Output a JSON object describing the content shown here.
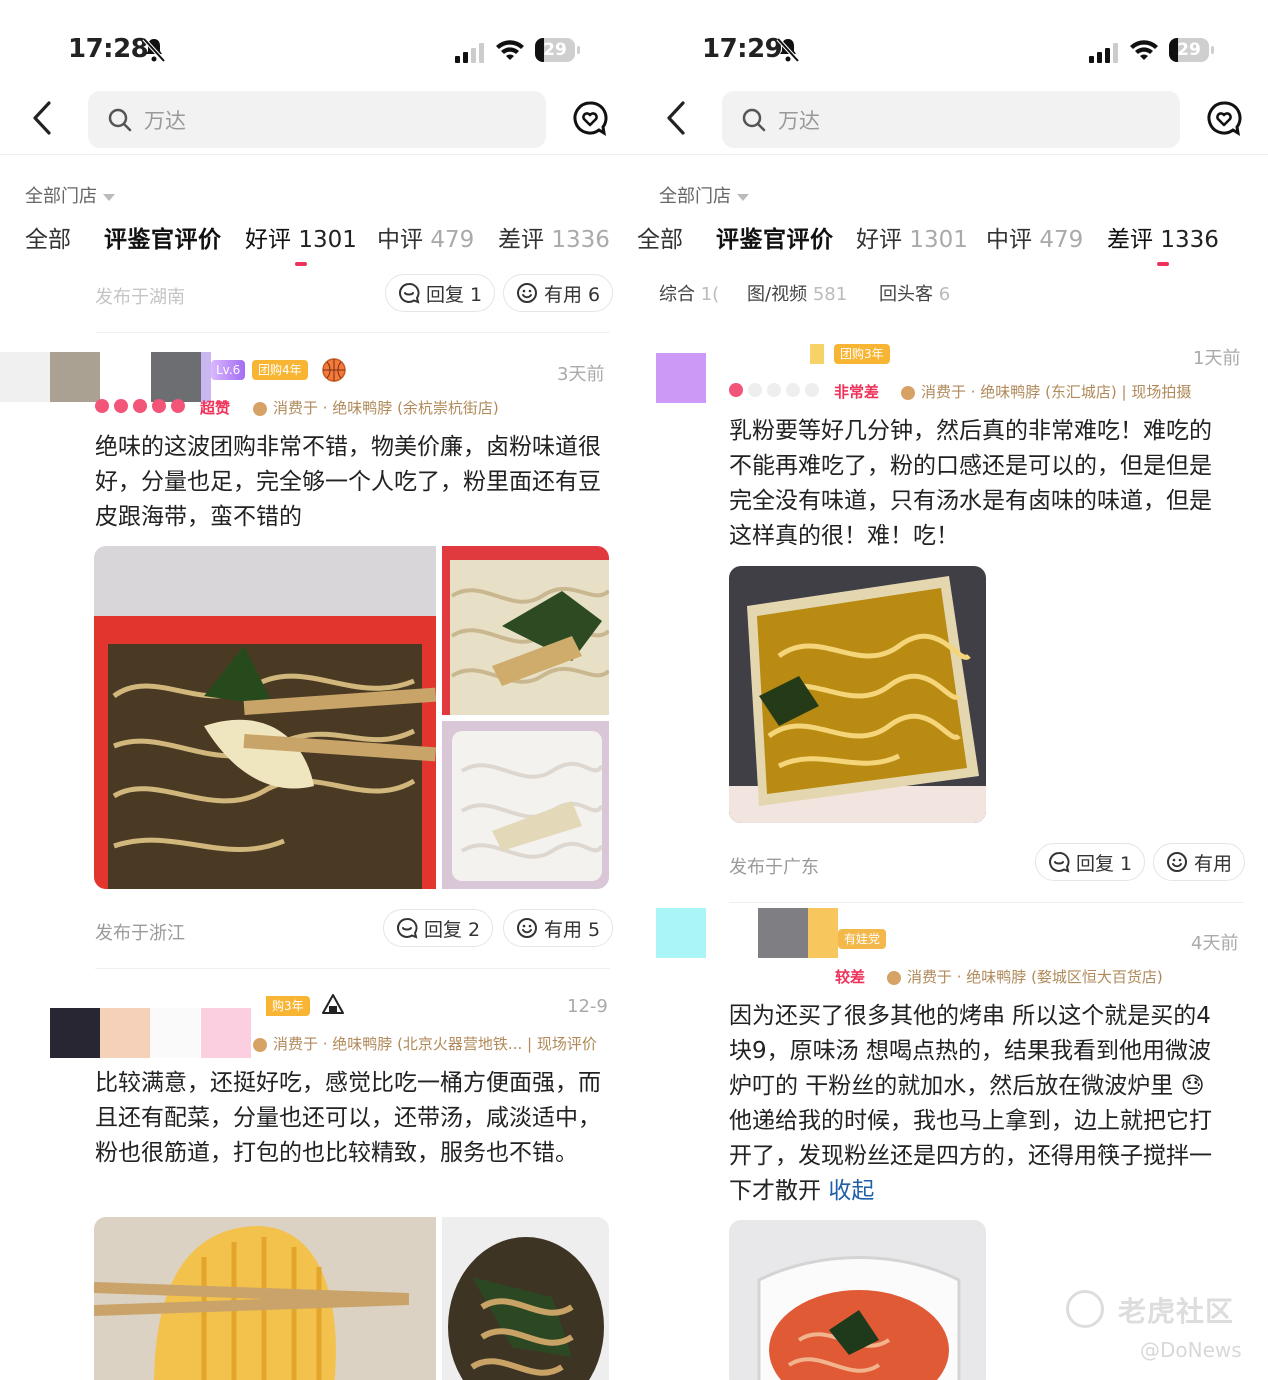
{
  "left": {
    "status": {
      "time": "17:28",
      "battery": "29"
    },
    "search": {
      "placeholder": "万达"
    },
    "store_filter": "全部门店",
    "tabs": [
      {
        "label": "全部",
        "count": ""
      },
      {
        "label": "评鉴官评价",
        "count": ""
      },
      {
        "label": "好评",
        "count": "1301"
      },
      {
        "label": "中评",
        "count": "479"
      },
      {
        "label": "差评",
        "count": "1336"
      }
    ],
    "prev_footer": {
      "location": "发布于湖南",
      "reply": "回复 1",
      "useful": "有用 6"
    },
    "reviews": [
      {
        "level": "Lv.6",
        "groupbuy": "团购4年",
        "time": "3天前",
        "rating_label": "超赞",
        "shop": "消费于 · 绝味鸭脖 (余杭崇杭街店)",
        "text": "绝味的这波团购非常不错，物美价廉，卤粉味道很好，分量也足，完全够一个人吃了，粉里面还有豆皮跟海带，蛮不错的",
        "location": "发布于浙江",
        "reply": "回复 2",
        "useful": "有用 5"
      },
      {
        "groupbuy": "购3年",
        "time": "12-9",
        "shop": "消费于 · 绝味鸭脖 (北京火器营地铁... | 现场评价",
        "text": "比较满意，还挺好吃，感觉比吃一桶方便面强，而且还有配菜，分量也还可以，还带汤，咸淡适中，粉也很筋道，打包的也比较精致，服务也不错。"
      }
    ]
  },
  "right": {
    "status": {
      "time": "17:29",
      "battery": "29"
    },
    "search": {
      "placeholder": "万达"
    },
    "store_filter": "全部门店",
    "tabs": [
      {
        "label": "全部",
        "count": ""
      },
      {
        "label": "评鉴官评价",
        "count": ""
      },
      {
        "label": "好评",
        "count": "1301"
      },
      {
        "label": "中评",
        "count": "479"
      },
      {
        "label": "差评",
        "count": "1336"
      }
    ],
    "subtabs": [
      {
        "label": "综合",
        "count": "1("
      },
      {
        "label": "图/视频",
        "count": "581"
      },
      {
        "label": "回头客",
        "count": "6"
      }
    ],
    "reviews": [
      {
        "groupbuy": "团购3年",
        "time": "1天前",
        "rating_label": "非常差",
        "shop": "消费于 · 绝味鸭脖 (东汇城店) | 现场拍摄",
        "text": "乳粉要等好几分钟，然后真的非常难吃！难吃的不能再难吃了，粉的口感还是可以的，但是但是完全没有味道，只有汤水是有卤味的味道，但是这样真的很！难！吃！",
        "location": "发布于广东",
        "reply": "回复 1",
        "useful": "有用"
      },
      {
        "badge": "有娃党",
        "time": "4天前",
        "rating_label": "较差",
        "shop": "消费于 · 绝味鸭脖 (婺城区恒大百货店)",
        "text": "因为还买了很多其他的烤串 所以这个就是买的4块9，原味汤 想喝点热的，结果我看到他用微波炉叮的 干粉丝的就加水，然后放在微波炉里 😓 他递给我的时候，我也马上拿到，边上就把它打开了，发现粉丝还是四方的，还得用筷子搅拌一下才散开",
        "collapse": "收起"
      }
    ]
  },
  "watermark": {
    "brand": "老虎社区",
    "handle": "@DoNews"
  }
}
